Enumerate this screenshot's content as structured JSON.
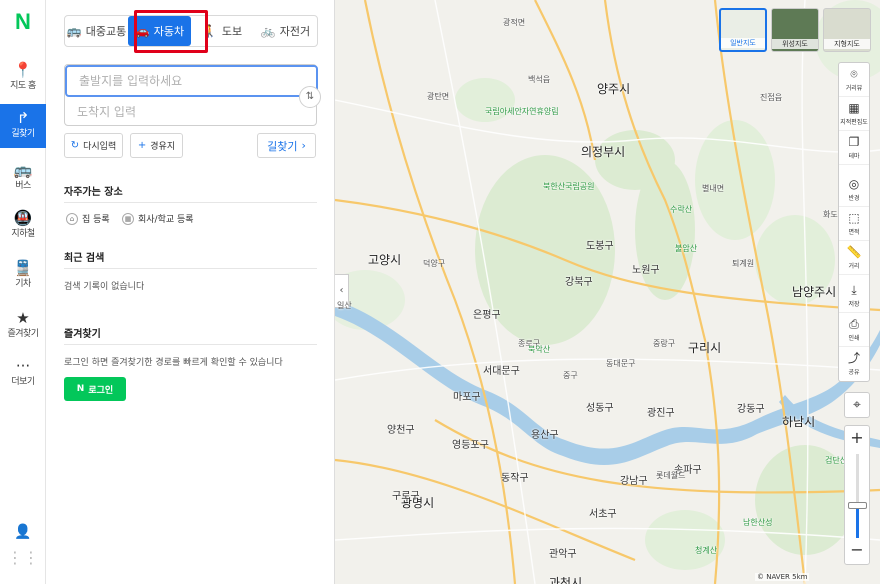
{
  "rail": {
    "logo": "N",
    "items": [
      {
        "label": "지도 홈",
        "icon": "map-pin-icon"
      },
      {
        "label": "길찾기",
        "icon": "directions-icon"
      },
      {
        "label": "버스",
        "icon": "bus-icon"
      },
      {
        "label": "지하철",
        "icon": "subway-icon"
      },
      {
        "label": "기차",
        "icon": "train-icon"
      },
      {
        "label": "즐겨찾기",
        "icon": "star-icon"
      },
      {
        "label": "더보기",
        "icon": "more-icon"
      }
    ]
  },
  "modes": [
    {
      "label": "대중교통",
      "icon": "bus-icon"
    },
    {
      "label": "자동차",
      "icon": "car-icon"
    },
    {
      "label": "도보",
      "icon": "walk-icon"
    },
    {
      "label": "자전거",
      "icon": "bike-icon"
    }
  ],
  "route": {
    "start_placeholder": "출발지를 입력하세요",
    "end_placeholder": "도착지 입력",
    "reset_label": "다시입력",
    "waypoint_label": "경유지",
    "find_label": "길찾기"
  },
  "frequent": {
    "title": "자주가는 장소",
    "home_label": "집 등록",
    "work_label": "회사/학교 등록"
  },
  "recent": {
    "title": "최근 검색",
    "empty": "검색 기록이 없습니다"
  },
  "favorites": {
    "title": "즐겨찾기",
    "desc": "로그인 하면 즐겨찾기한 경로를 빠르게 확인할 수 있습니다",
    "login_label": "로그인"
  },
  "map": {
    "tiles": [
      "일반지도",
      "위성지도",
      "지형지도"
    ],
    "tools": [
      "거리뷰",
      "지적편집도",
      "테마",
      "반경",
      "면적",
      "거리",
      "저장",
      "인쇄",
      "공유"
    ],
    "copyright": "© NAVER",
    "scale": "5km",
    "places": [
      {
        "name": "광적면"
      },
      {
        "name": "양주시"
      },
      {
        "name": "백석읍"
      },
      {
        "name": "광탄면"
      },
      {
        "name": "의정부시"
      },
      {
        "name": "고양시"
      },
      {
        "name": "남양주시"
      },
      {
        "name": "구리시"
      },
      {
        "name": "하남시"
      },
      {
        "name": "서대문구"
      },
      {
        "name": "마포구"
      },
      {
        "name": "용산구"
      },
      {
        "name": "광명시"
      },
      {
        "name": "강북구"
      },
      {
        "name": "도봉구"
      },
      {
        "name": "노원구"
      },
      {
        "name": "은평구"
      },
      {
        "name": "성동구"
      },
      {
        "name": "광진구"
      },
      {
        "name": "강동구"
      },
      {
        "name": "영등포구"
      },
      {
        "name": "동작구"
      },
      {
        "name": "관악구"
      },
      {
        "name": "서초구"
      },
      {
        "name": "강남구"
      },
      {
        "name": "송파구"
      },
      {
        "name": "양천구"
      },
      {
        "name": "구로구"
      },
      {
        "name": "덕양구"
      },
      {
        "name": "일산"
      },
      {
        "name": "별내면"
      },
      {
        "name": "진접읍"
      },
      {
        "name": "화도읍"
      },
      {
        "name": "퇴계원"
      },
      {
        "name": "동대문구"
      },
      {
        "name": "중랑구"
      },
      {
        "name": "종로구"
      },
      {
        "name": "중구"
      },
      {
        "name": "과천시"
      },
      {
        "name": "롯데월드"
      }
    ],
    "parks": [
      {
        "name": "북한산국립공원"
      },
      {
        "name": "수락산"
      },
      {
        "name": "불암산"
      },
      {
        "name": "국립아세안자연휴양림"
      },
      {
        "name": "북악산"
      },
      {
        "name": "청계산"
      },
      {
        "name": "남한산성"
      },
      {
        "name": "검단산"
      }
    ]
  }
}
